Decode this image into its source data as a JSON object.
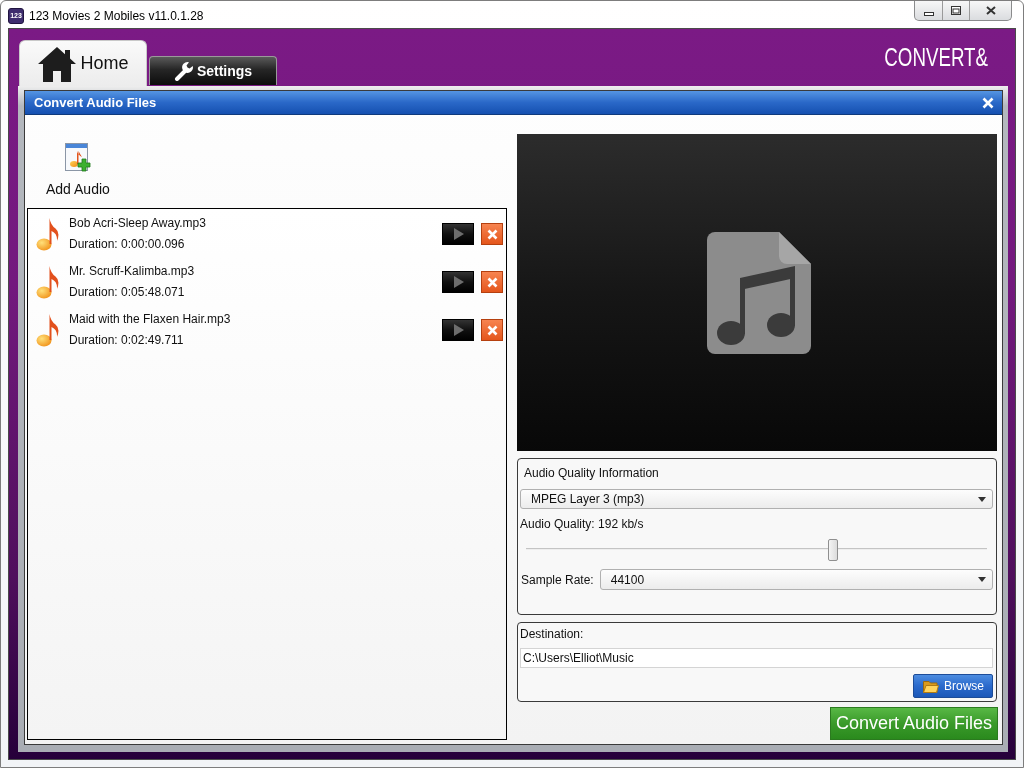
{
  "window": {
    "app_icon_text": "123",
    "title": "123 Movies 2 Mobiles v11.0.1.28"
  },
  "tabs": [
    {
      "label": "Home",
      "selected": true
    },
    {
      "label": "Settings",
      "selected": false
    }
  ],
  "logo": {
    "text": "CONVERT&"
  },
  "dialog": {
    "title": "Convert Audio Files"
  },
  "add_audio": {
    "label": "Add Audio"
  },
  "files": [
    {
      "name": "Bob Acri-Sleep Away.mp3",
      "duration": "Duration: 0:00:00.096"
    },
    {
      "name": "Mr. Scruff-Kalimba.mp3",
      "duration": "Duration: 0:05:48.071"
    },
    {
      "name": "Maid with the Flaxen Hair.mp3",
      "duration": "Duration: 0:02:49.711"
    }
  ],
  "audio_quality": {
    "heading": "Audio Quality Information",
    "format": "MPEG Layer 3 (mp3)",
    "quality_label": "Audio Quality: 192 kb/s",
    "level": 0.667,
    "sample_rate_label": "Sample Rate:",
    "sample_rate": "44100"
  },
  "destination": {
    "label": "Destination:",
    "path": "C:\\Users\\Elliot\\Music",
    "browse": "Browse"
  },
  "convert_button": {
    "label": "Convert Audio Files"
  }
}
